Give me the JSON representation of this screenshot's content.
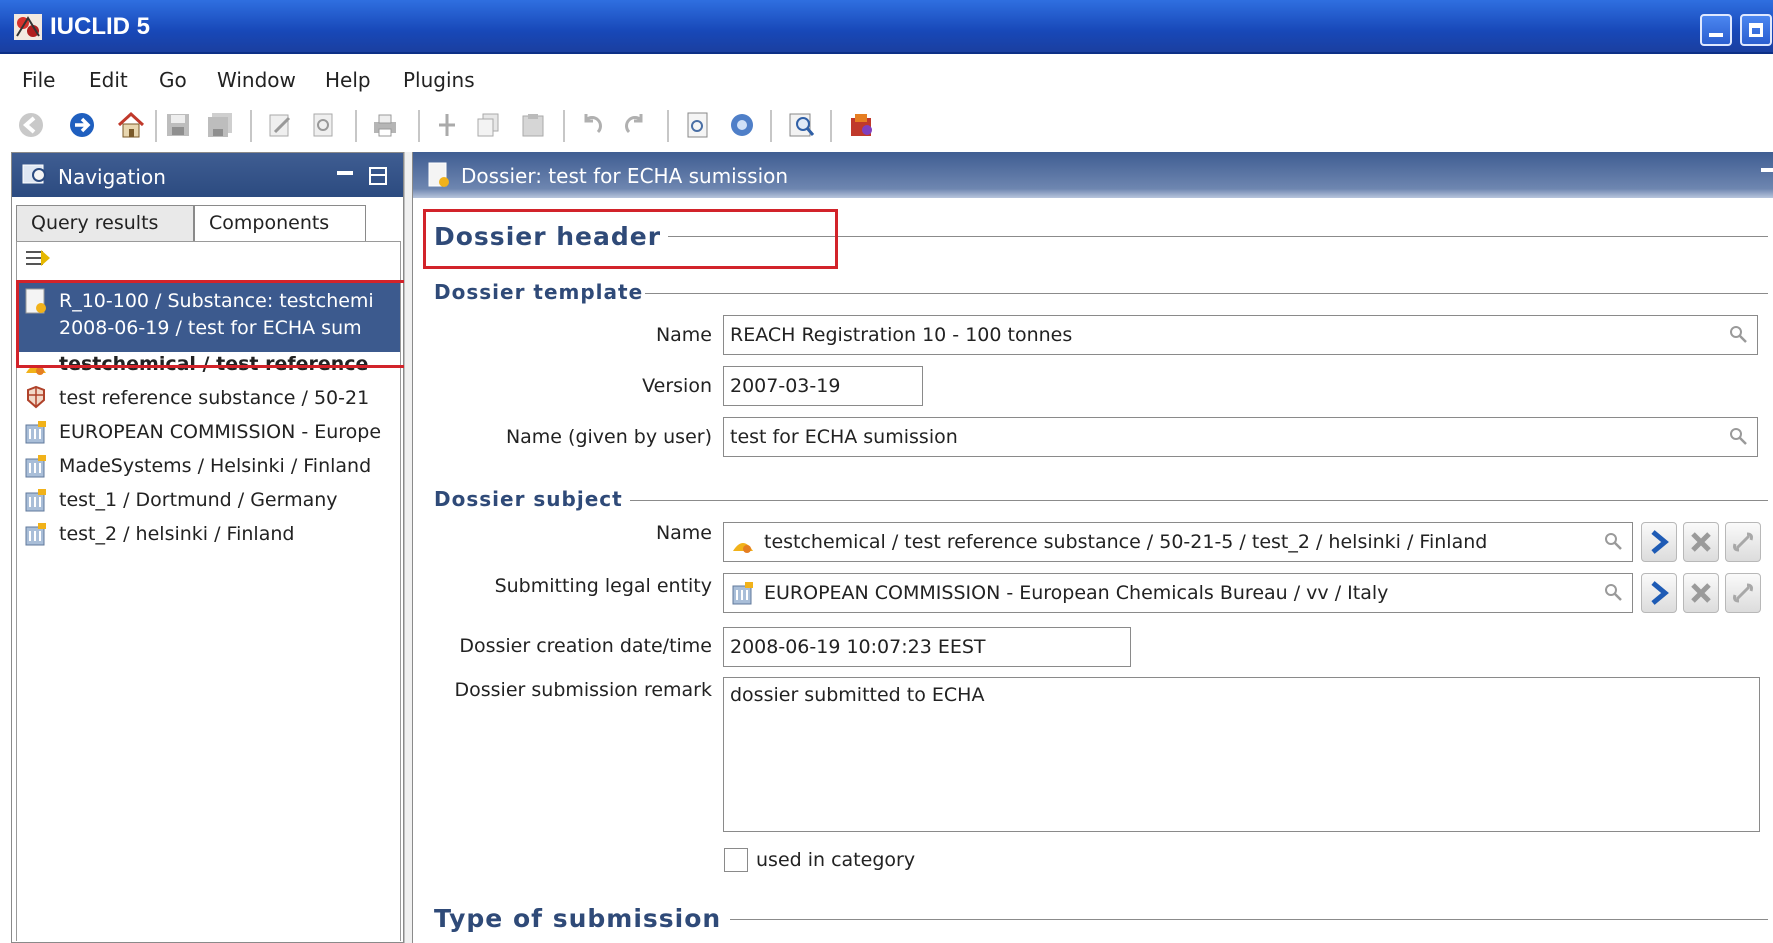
{
  "window": {
    "title": "IUCLID 5"
  },
  "menu": [
    "File",
    "Edit",
    "Go",
    "Window",
    "Help",
    "Plugins"
  ],
  "toolbar": {
    "icons": [
      "back-icon",
      "forward-icon",
      "home-icon",
      "save-icon",
      "save-all-icon",
      "edit-icon",
      "preview-icon",
      "print-icon",
      "cut-icon",
      "copy-icon",
      "paste-icon",
      "undo-icon",
      "redo-icon",
      "document-info-icon",
      "help-icon",
      "search-help-icon",
      "plugin-icon"
    ]
  },
  "navigation": {
    "title": "Navigation",
    "tabs": [
      "Query results",
      "Components"
    ],
    "items": [
      {
        "line1": "R_10-100 / Substance: testchemi",
        "line2": "2008-06-19 / test for ECHA sum",
        "icon": "dossier-icon",
        "selected": true
      },
      {
        "label": "testchemical / test reference",
        "icon": "substance-icon",
        "bold": true
      },
      {
        "label": "test reference substance / 50-21",
        "icon": "reference-substance-icon"
      },
      {
        "label": "EUROPEAN COMMISSION - Europe",
        "icon": "legal-entity-icon"
      },
      {
        "label": "MadeSystems / Helsinki / Finland",
        "icon": "legal-entity-icon"
      },
      {
        "label": "test_1 / Dortmund / Germany",
        "icon": "legal-entity-icon"
      },
      {
        "label": "test_2 / helsinki / Finland",
        "icon": "legal-entity-icon"
      }
    ]
  },
  "editor": {
    "title": "Dossier: test for ECHA sumission",
    "dossier_header": "Dossier header",
    "template": {
      "section": "Dossier template",
      "name_label": "Name",
      "name_value": "REACH Registration 10 - 100 tonnes",
      "version_label": "Version",
      "version_value": "2007-03-19",
      "user_name_label": "Name (given by user)",
      "user_name_value": "test for ECHA sumission"
    },
    "subject": {
      "section": "Dossier subject",
      "name_label": "Name",
      "name_value": "testchemical / test reference substance / 50-21-5 / test_2 / helsinki / Finland",
      "entity_label": "Submitting legal entity",
      "entity_value": "EUROPEAN COMMISSION - European Chemicals Bureau / vv / Italy",
      "creation_label": "Dossier creation date/time",
      "creation_value": "2008-06-19 10:07:23 EEST",
      "remark_label": "Dossier submission remark",
      "remark_value": "dossier submitted to ECHA",
      "category_label": "used in category",
      "category_checked": false
    },
    "type_of_submission": "Type of submission"
  }
}
